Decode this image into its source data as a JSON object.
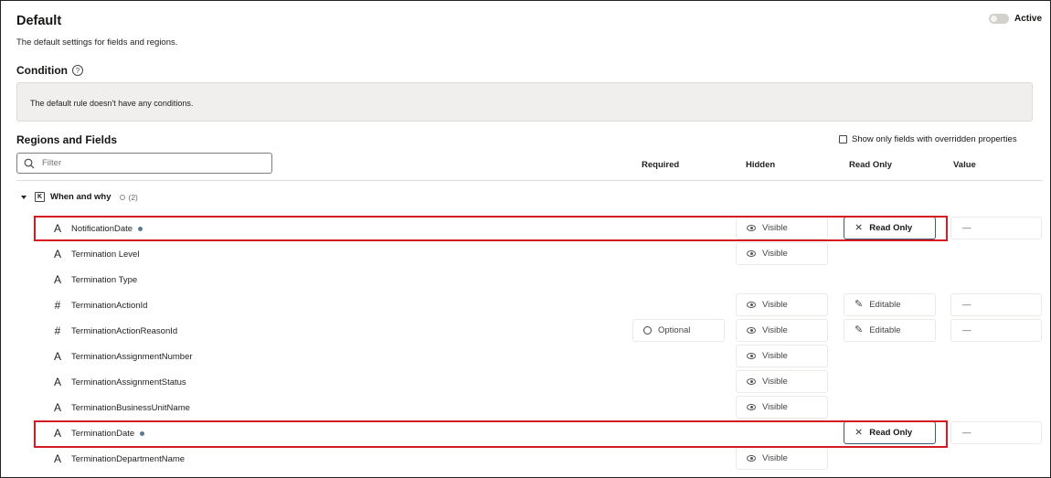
{
  "header": {
    "title": "Default",
    "subtitle": "The default settings for fields and regions.",
    "active_label": "Active"
  },
  "condition": {
    "heading": "Condition",
    "help_icon": "?",
    "text": "The default rule doesn't have any conditions."
  },
  "regions": {
    "heading": "Regions and Fields",
    "override_label": "Show only fields with overridden properties",
    "filter_placeholder": "Filter",
    "columns": {
      "required": "Required",
      "hidden": "Hidden",
      "read_only": "Read Only",
      "value": "Value"
    },
    "group": {
      "icon": "K",
      "label": "When and why",
      "count": "(2)"
    }
  },
  "rows": [
    {
      "type": "A",
      "name": "NotificationDate",
      "overridden": true,
      "required": "",
      "hidden": "Visible",
      "read_only": "Read Only",
      "value": "—"
    },
    {
      "type": "A",
      "name": "Termination Level",
      "required": "",
      "hidden": "Visible",
      "read_only": "",
      "value": ""
    },
    {
      "type": "A",
      "name": "Termination Type",
      "required": "",
      "hidden": "",
      "read_only": "",
      "value": ""
    },
    {
      "type": "#",
      "name": "TerminationActionId",
      "required": "",
      "hidden": "Visible",
      "read_only": "Editable",
      "value": "—"
    },
    {
      "type": "#",
      "name": "TerminationActionReasonId",
      "required": "Optional",
      "hidden": "Visible",
      "read_only": "Editable",
      "value": "—"
    },
    {
      "type": "A",
      "name": "TerminationAssignmentNumber",
      "required": "",
      "hidden": "Visible",
      "read_only": "",
      "value": ""
    },
    {
      "type": "A",
      "name": "TerminationAssignmentStatus",
      "required": "",
      "hidden": "Visible",
      "read_only": "",
      "value": ""
    },
    {
      "type": "A",
      "name": "TerminationBusinessUnitName",
      "required": "",
      "hidden": "Visible",
      "read_only": "",
      "value": ""
    },
    {
      "type": "A",
      "name": "TerminationDate",
      "overridden": true,
      "required": "",
      "hidden": "",
      "read_only": "Read Only",
      "value": "—"
    },
    {
      "type": "A",
      "name": "TerminationDepartmentName",
      "required": "",
      "hidden": "Visible",
      "read_only": "",
      "value": ""
    }
  ],
  "icons": {
    "hidden_visible": "eye-icon",
    "required_optional": "radio-icon",
    "editable": "pencil-icon",
    "read_only": "read-only-icon",
    "filter": "search-icon"
  },
  "colors": {
    "highlight": "#d71920",
    "override_dot": "#5b7a96",
    "condition_bg": "#f1efed"
  }
}
